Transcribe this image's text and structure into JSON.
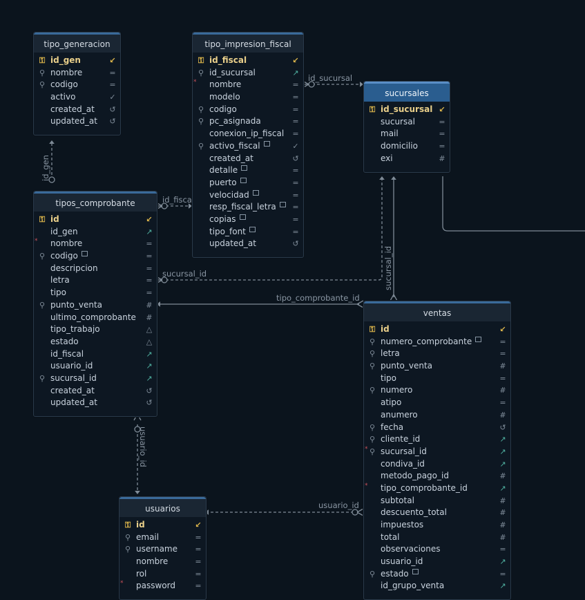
{
  "diagram": {
    "tables": [
      {
        "id": "tipo_generacion",
        "name": "tipo_generacion",
        "selected": false,
        "columns": [
          {
            "name": "id_gen",
            "left": "key",
            "right": "pk"
          },
          {
            "name": "nombre",
            "left": "search",
            "right": "text"
          },
          {
            "name": "codigo",
            "left": "search",
            "right": "text"
          },
          {
            "name": "activo",
            "left": "",
            "right": "bool"
          },
          {
            "name": "created_at",
            "left": "",
            "right": "time"
          },
          {
            "name": "updated_at",
            "left": "",
            "right": "time"
          }
        ]
      },
      {
        "id": "tipo_impresion_fiscal",
        "name": "tipo_impresion_fiscal",
        "selected": false,
        "columns": [
          {
            "name": "id_fiscal",
            "left": "key",
            "right": "pk"
          },
          {
            "name": "id_sucursal",
            "left": "search",
            "right": "fk"
          },
          {
            "name": "nombre",
            "left": "",
            "right": "text",
            "required": true
          },
          {
            "name": "modelo",
            "left": "",
            "right": "text"
          },
          {
            "name": "codigo",
            "left": "search",
            "right": "text"
          },
          {
            "name": "pc_asignada",
            "left": "search",
            "right": "text"
          },
          {
            "name": "conexion_ip_fiscal",
            "left": "",
            "right": "text"
          },
          {
            "name": "activo_fiscal",
            "left": "search",
            "right": "bool",
            "comment": true
          },
          {
            "name": "created_at",
            "left": "",
            "right": "time"
          },
          {
            "name": "detalle",
            "left": "",
            "right": "text",
            "comment": true
          },
          {
            "name": "puerto",
            "left": "",
            "right": "text",
            "comment": true
          },
          {
            "name": "velocidad",
            "left": "",
            "right": "text",
            "comment": true
          },
          {
            "name": "resp_fiscal_letra",
            "left": "",
            "right": "text",
            "comment": true
          },
          {
            "name": "copias",
            "left": "",
            "right": "text",
            "comment": true
          },
          {
            "name": "tipo_font",
            "left": "",
            "right": "text",
            "comment": true
          },
          {
            "name": "updated_at",
            "left": "",
            "right": "time"
          }
        ]
      },
      {
        "id": "sucursales",
        "name": "sucursales",
        "selected": true,
        "columns": [
          {
            "name": "id_sucursal",
            "left": "key",
            "right": "pk"
          },
          {
            "name": "sucursal",
            "left": "",
            "right": "text"
          },
          {
            "name": "mail",
            "left": "",
            "right": "text"
          },
          {
            "name": "domicilio",
            "left": "",
            "right": "text"
          },
          {
            "name": "exi",
            "left": "",
            "right": "num"
          }
        ]
      },
      {
        "id": "tipos_comprobante",
        "name": "tipos_comprobante",
        "selected": false,
        "columns": [
          {
            "name": "id",
            "left": "key",
            "right": "pk"
          },
          {
            "name": "id_gen",
            "left": "",
            "right": "fk"
          },
          {
            "name": "nombre",
            "left": "",
            "right": "text",
            "required": true
          },
          {
            "name": "codigo",
            "left": "search",
            "right": "text",
            "comment": true
          },
          {
            "name": "descripcion",
            "left": "",
            "right": "text"
          },
          {
            "name": "letra",
            "left": "",
            "right": "text"
          },
          {
            "name": "tipo",
            "left": "",
            "right": "text"
          },
          {
            "name": "punto_venta",
            "left": "search",
            "right": "num"
          },
          {
            "name": "ultimo_comprobante",
            "left": "",
            "right": "num"
          },
          {
            "name": "tipo_trabajo",
            "left": "",
            "right": "enum"
          },
          {
            "name": "estado",
            "left": "",
            "right": "enum"
          },
          {
            "name": "id_fiscal",
            "left": "",
            "right": "fk"
          },
          {
            "name": "usuario_id",
            "left": "",
            "right": "fk"
          },
          {
            "name": "sucursal_id",
            "left": "search",
            "right": "fk"
          },
          {
            "name": "created_at",
            "left": "",
            "right": "time"
          },
          {
            "name": "updated_at",
            "left": "",
            "right": "time"
          }
        ]
      },
      {
        "id": "ventas",
        "name": "ventas",
        "selected": false,
        "columns": [
          {
            "name": "id",
            "left": "key",
            "right": "pk"
          },
          {
            "name": "numero_comprobante",
            "left": "search",
            "right": "text",
            "comment": true
          },
          {
            "name": "letra",
            "left": "search",
            "right": "text"
          },
          {
            "name": "punto_venta",
            "left": "search",
            "right": "num"
          },
          {
            "name": "tipo",
            "left": "",
            "right": "text"
          },
          {
            "name": "numero",
            "left": "search",
            "right": "num"
          },
          {
            "name": "atipo",
            "left": "",
            "right": "text"
          },
          {
            "name": "anumero",
            "left": "",
            "right": "num"
          },
          {
            "name": "fecha",
            "left": "search",
            "right": "time"
          },
          {
            "name": "cliente_id",
            "left": "search",
            "right": "fk"
          },
          {
            "name": "sucursal_id",
            "left": "search",
            "right": "fk",
            "required": true
          },
          {
            "name": "condiva_id",
            "left": "",
            "right": "fk"
          },
          {
            "name": "metodo_pago_id",
            "left": "",
            "right": "num"
          },
          {
            "name": "tipo_comprobante_id",
            "left": "",
            "right": "fk",
            "required": true
          },
          {
            "name": "subtotal",
            "left": "",
            "right": "num"
          },
          {
            "name": "descuento_total",
            "left": "",
            "right": "num"
          },
          {
            "name": "impuestos",
            "left": "",
            "right": "num"
          },
          {
            "name": "total",
            "left": "",
            "right": "num"
          },
          {
            "name": "observaciones",
            "left": "",
            "right": "text"
          },
          {
            "name": "usuario_id",
            "left": "",
            "right": "fk"
          },
          {
            "name": "estado",
            "left": "search",
            "right": "text",
            "comment": true
          },
          {
            "name": "id_grupo_venta",
            "left": "",
            "right": "fk"
          }
        ]
      },
      {
        "id": "usuarios",
        "name": "usuarios",
        "selected": false,
        "columns": [
          {
            "name": "id",
            "left": "key",
            "right": "pk"
          },
          {
            "name": "email",
            "left": "search",
            "right": "text"
          },
          {
            "name": "username",
            "left": "search",
            "right": "text"
          },
          {
            "name": "nombre",
            "left": "",
            "right": "text"
          },
          {
            "name": "rol",
            "left": "",
            "right": "text"
          },
          {
            "name": "password",
            "left": "",
            "right": "text",
            "required": true
          }
        ]
      }
    ],
    "edges": [
      {
        "id": "e-id-gen",
        "label": "id_gen"
      },
      {
        "id": "e-id-fiscal",
        "label": "id_fiscal"
      },
      {
        "id": "e-id-sucursal",
        "label": "id_sucursal"
      },
      {
        "id": "e-sucursal-id-tc",
        "label": "sucursal_id"
      },
      {
        "id": "e-sucursal-id-v",
        "label": "sucursal_id"
      },
      {
        "id": "e-tipo-comprobante-id",
        "label": "tipo_comprobante_id"
      },
      {
        "id": "e-usuario-id-tc",
        "label": "usuario_id"
      },
      {
        "id": "e-usuario-id-v",
        "label": "usuario_id"
      }
    ]
  },
  "colors": {
    "background": "#0b141d",
    "edge": "#7f8b97",
    "pk_key": "#e0b84c",
    "fk_arrow": "#4fb0a0",
    "selected_header": "#2a5d8f"
  }
}
